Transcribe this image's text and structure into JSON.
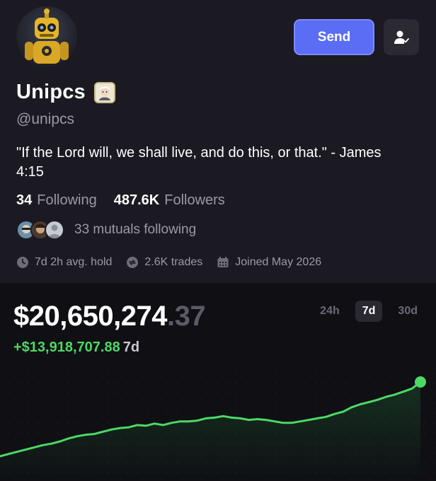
{
  "profile": {
    "name": "Unipcs",
    "handle": "@unipcs",
    "bio": "\"If the Lord will, we shall live, and do this, or that.\" - James 4:15",
    "following_count": "34",
    "following_label": "Following",
    "followers_count": "487.6K",
    "followers_label": "Followers",
    "mutuals_text": "33 mutuals following",
    "avg_hold": "7d 2h avg. hold",
    "trades": "2.6K trades",
    "joined": "Joined May 2026"
  },
  "actions": {
    "send_label": "Send"
  },
  "portfolio": {
    "balance_main": "$20,650,274",
    "balance_cents": ".37",
    "change": "+$13,918,707.88",
    "change_period": "7d",
    "ranges": [
      "24h",
      "7d",
      "30d"
    ],
    "active_range": "7d"
  },
  "colors": {
    "accent": "#5b6cf5",
    "positive": "#4cd964",
    "background": "#1b1a22",
    "chart_bg": "#0f0f14"
  },
  "chart_data": {
    "type": "line",
    "x_label": "",
    "y_label": "",
    "grid": true,
    "values": [
      0.0,
      0.03,
      0.06,
      0.09,
      0.12,
      0.15,
      0.17,
      0.2,
      0.24,
      0.27,
      0.29,
      0.3,
      0.33,
      0.36,
      0.38,
      0.39,
      0.42,
      0.41,
      0.44,
      0.42,
      0.45,
      0.47,
      0.47,
      0.48,
      0.51,
      0.52,
      0.54,
      0.52,
      0.51,
      0.49,
      0.5,
      0.49,
      0.47,
      0.45,
      0.45,
      0.47,
      0.49,
      0.51,
      0.53,
      0.57,
      0.6,
      0.66,
      0.7,
      0.73,
      0.76,
      0.8,
      0.83,
      0.87,
      0.91,
      1.0
    ]
  }
}
